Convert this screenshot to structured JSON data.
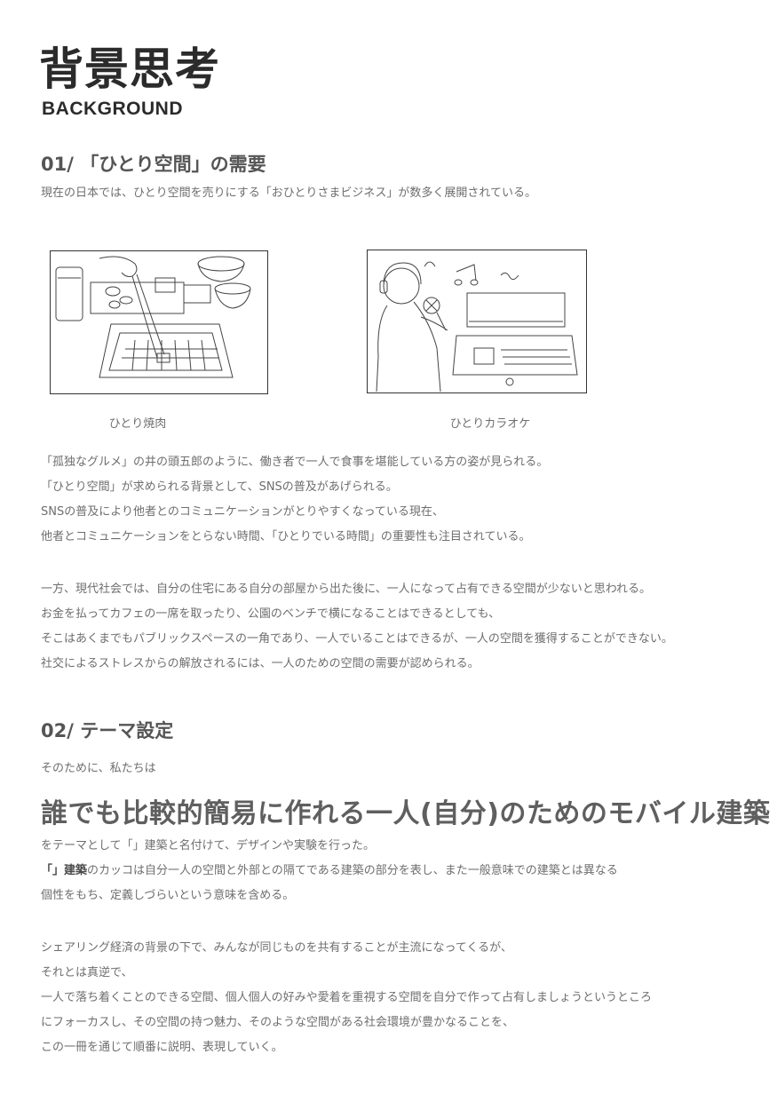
{
  "header": {
    "title": "背景思考",
    "subtitle": "BACKGROUND"
  },
  "section1": {
    "heading": "01/ 「ひとり空間」の需要",
    "intro": "現在の日本では、ひとり空間を売りにする「おひとりさまビジネス」が数多く展開されている。",
    "images": [
      {
        "caption": "ひとり焼肉",
        "icon": "yakiniku-sketch-icon"
      },
      {
        "caption": "ひとりカラオケ",
        "icon": "karaoke-sketch-icon"
      }
    ],
    "paragraph1": [
      "「孤独なグルメ」の井の頭五郎のように、働き者で一人で食事を堪能している方の姿が見られる。",
      "「ひとり空間」が求められる背景として、SNSの普及があげられる。",
      "SNSの普及により他者とのコミュニケーションがとりやすくなっている現在、",
      "他者とコミュニケーションをとらない時間、「ひとりでいる時間」の重要性も注目されている。"
    ],
    "paragraph2": [
      "一方、現代社会では、自分の住宅にある自分の部屋から出た後に、一人になって占有できる空間が少ないと思われる。",
      "お金を払ってカフェの一席を取ったり、公園のベンチで横になることはできるとしても、",
      "そこはあくまでもパブリックスペースの一角であり、一人でいることはできるが、一人の空間を獲得することができない。",
      "社交によるストレスからの解放されるには、一人のための空間の需要が認められる。"
    ]
  },
  "section2": {
    "heading": "02/ テーマ設定",
    "lead": "そのために、私たちは",
    "headline": "誰でも比較的簡易に作れる一人(自分)のためのモバイル建築",
    "line1": "をテーマとして「」建築と名付けて、デザインや実験を行った。",
    "line2_bold": "「」建築",
    "line2_rest": "のカッコは自分一人の空間と外部との隔てである建築の部分を表し、また一般意味での建築とは異なる",
    "line3": "個性をもち、定義しづらいという意味を含める。",
    "paragraph": [
      "シェアリング経済の背景の下で、みんなが同じものを共有することが主流になってくるが、",
      "それとは真逆で、",
      "一人で落ち着くことのできる空間、個人個人の好みや愛着を重視する空間を自分で作って占有しましょうというところ",
      "にフォーカスし、その空間の持つ魅力、そのような空間がある社会環境が豊かなることを、",
      "この一冊を通じて順番に説明、表現していく。"
    ]
  }
}
